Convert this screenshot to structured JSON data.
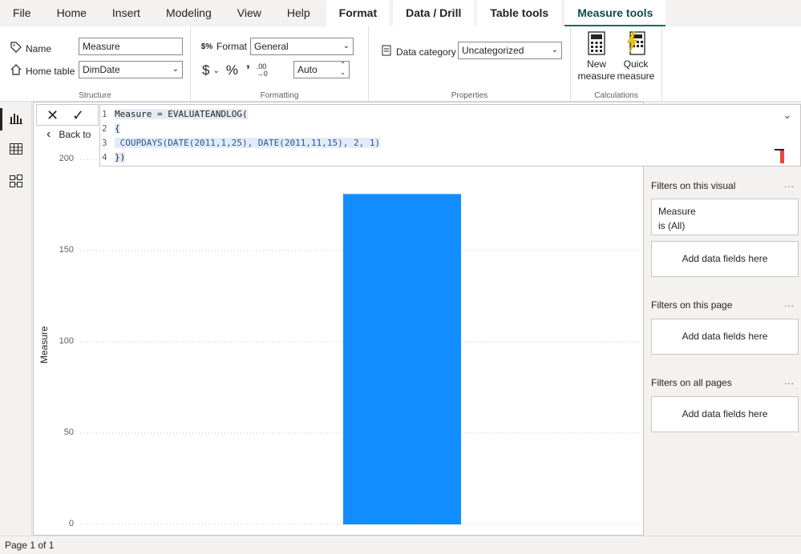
{
  "menubar": {
    "items": [
      "File",
      "Home",
      "Insert",
      "Modeling",
      "View",
      "Help"
    ],
    "contextual": [
      "Format",
      "Data / Drill",
      "Table tools",
      "Measure tools"
    ],
    "active": "Measure tools"
  },
  "ribbon": {
    "structure": {
      "label": "Structure",
      "name_label": "Name",
      "name_value": "Measure",
      "home_table_label": "Home table",
      "home_table_value": "DimDate"
    },
    "formatting": {
      "label": "Formatting",
      "format_label": "Format",
      "format_value": "General",
      "currency_symbol": "$",
      "percent_symbol": "%",
      "comma_symbol": "’",
      "decimals_value": "Auto"
    },
    "properties": {
      "label": "Properties",
      "data_category_label": "Data category",
      "data_category_value": "Uncategorized"
    },
    "calculations": {
      "label": "Calculations",
      "new_measure_line1": "New",
      "new_measure_line2": "measure",
      "quick_measure_line1": "Quick",
      "quick_measure_line2": "measure"
    }
  },
  "formula": {
    "lines": [
      {
        "n": "1",
        "text": "Measure = EVALUATEANDLOG("
      },
      {
        "n": "2",
        "text": "{"
      },
      {
        "n": "3",
        "text": " COUPDAYS(DATE(2011,1,25), DATE(2011,11,15), 2, 1)"
      },
      {
        "n": "4",
        "text": "})"
      }
    ],
    "back_label": "Back to"
  },
  "chart_data": {
    "type": "bar",
    "categories": [
      ""
    ],
    "values": [
      181
    ],
    "ylabel": "Measure",
    "ylim": [
      0,
      200
    ],
    "yticks": [
      "200",
      "150",
      "100",
      "50",
      "0"
    ],
    "grid": true,
    "bar_color": "#118DFF"
  },
  "filters": {
    "on_visual_title": "Filters on this visual",
    "measure_name": "Measure",
    "measure_state": "is (All)",
    "add_label": "Add data fields here",
    "on_page_title": "Filters on this page",
    "on_all_title": "Filters on all pages",
    "more": "..."
  },
  "status": {
    "page": "Page 1 of 1"
  }
}
